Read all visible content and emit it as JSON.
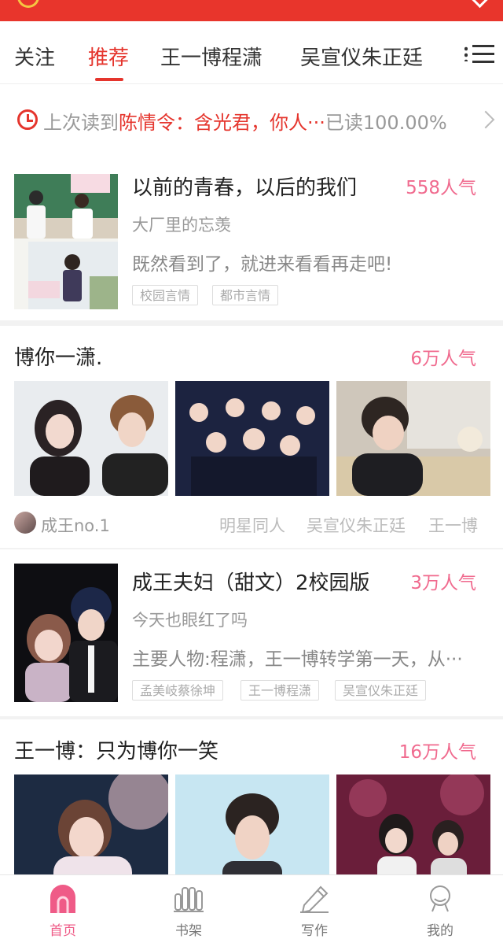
{
  "colors": {
    "brand_red": "#e5352d",
    "popularity_pink": "#f06a8e",
    "nav_active": "#ef5b87"
  },
  "tabs": [
    {
      "label": "关注",
      "active": false
    },
    {
      "label": "推荐",
      "active": true
    },
    {
      "label": "王一博程潇",
      "active": false
    },
    {
      "label": "吴宣仪朱正廷",
      "active": false
    }
  ],
  "history": {
    "prefix": "上次读到",
    "book": "陈情令：含光君，你人···",
    "progress": "已读100.00%"
  },
  "books": [
    {
      "title": "以前的青春，以后的我们",
      "popularity": "558人气",
      "author": "大厂里的忘羡",
      "desc": "既然看到了，就进来看看再走吧!",
      "tags": [
        "校园言情",
        "都市言情"
      ]
    },
    {
      "title": "成王夫妇（甜文）2校园版",
      "popularity": "3万人气",
      "author": "今天也眼红了吗",
      "desc": "主要人物:程潇，王一博转学第一天，从···",
      "tags": [
        "孟美岐蔡徐坤",
        "王一博程潇",
        "吴宣仪朱正廷"
      ]
    }
  ],
  "sections": [
    {
      "title": "博你一潇.",
      "popularity": "6万人气",
      "uploader": "成王no.1",
      "tags": [
        "明星同人",
        "吴宣仪朱正廷",
        "王一博"
      ]
    },
    {
      "title": "王一博：只为博你一笑",
      "popularity": "16万人气"
    }
  ],
  "nav": [
    {
      "label": "首页",
      "icon": "home-icon",
      "active": true
    },
    {
      "label": "书架",
      "icon": "bookshelf-icon",
      "active": false
    },
    {
      "label": "写作",
      "icon": "pen-icon",
      "active": false
    },
    {
      "label": "我的",
      "icon": "profile-icon",
      "active": false
    }
  ]
}
